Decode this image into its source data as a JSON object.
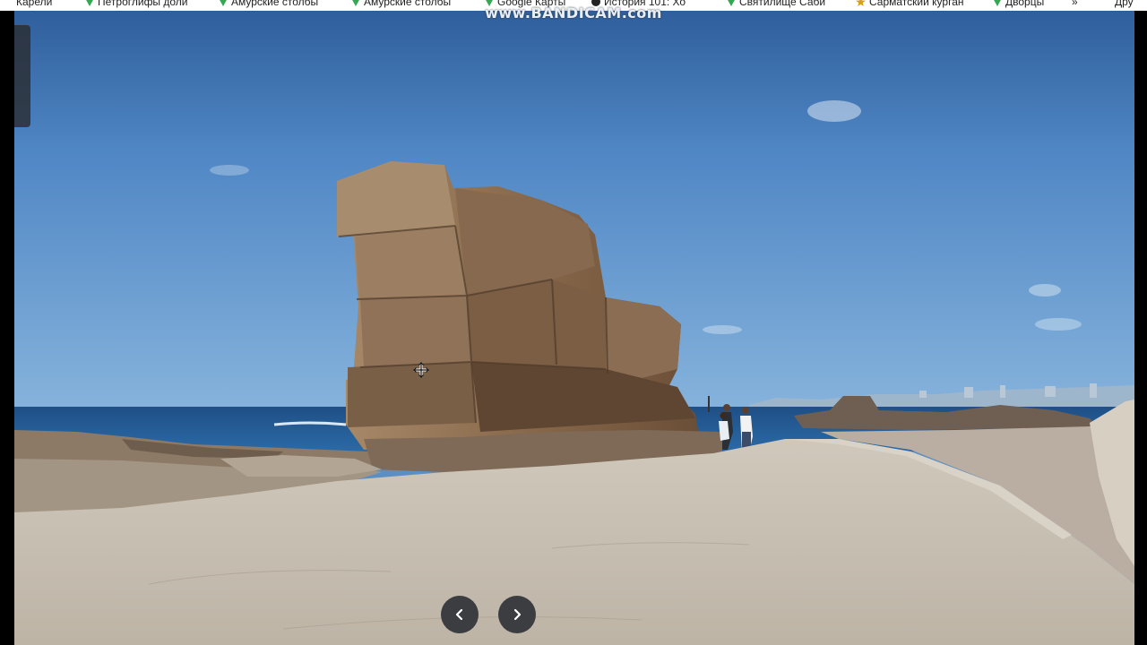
{
  "bookmarks": [
    {
      "label": "Карели",
      "icon": "none"
    },
    {
      "label": "Петроглифы доли",
      "icon": "map-pin-icon"
    },
    {
      "label": "Амурские столбы",
      "icon": "map-pin-icon"
    },
    {
      "label": "Амурские столбы",
      "icon": "map-pin-icon"
    },
    {
      "label": "Google Карты",
      "icon": "map-pin-icon"
    },
    {
      "label": "История 101: Хо",
      "icon": "circle-icon"
    },
    {
      "label": "Святилище Саби",
      "icon": "map-pin-icon"
    },
    {
      "label": "Сарматский курган",
      "icon": "star-icon"
    },
    {
      "label": "Дворцы",
      "icon": "map-pin-icon"
    },
    {
      "label": "»",
      "icon": "none"
    },
    {
      "label": "Дру",
      "icon": "none"
    }
  ],
  "watermark": "www.BANDICAM.com",
  "viewer": {
    "prev_label": "previous",
    "next_label": "next"
  }
}
